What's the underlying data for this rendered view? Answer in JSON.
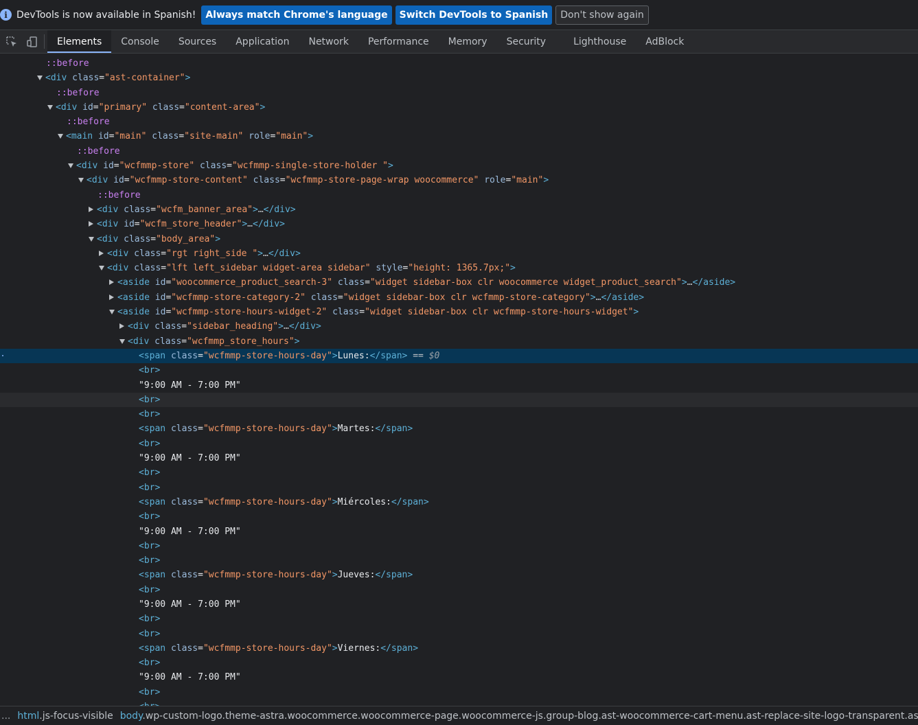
{
  "infobar": {
    "message": "DevTools is now available in Spanish!",
    "btn_match": "Always match Chrome's language",
    "btn_switch": "Switch DevTools to Spanish",
    "btn_dismiss": "Don't show again"
  },
  "tabs": [
    "Elements",
    "Console",
    "Sources",
    "Application",
    "Network",
    "Performance",
    "Memory",
    "Security",
    "Lighthouse",
    "AdBlock"
  ],
  "active_tab": "Elements",
  "tree": [
    {
      "indent": 67,
      "caret": "",
      "parts": [
        [
          "pseudo",
          "::before"
        ]
      ]
    },
    {
      "indent": 52,
      "caret": "open",
      "parts": [
        [
          "tag",
          "<div"
        ],
        [
          "attr",
          " class"
        ],
        [
          "plain",
          "="
        ],
        [
          "val",
          "\"ast-container\""
        ],
        [
          "tag",
          ">"
        ]
      ]
    },
    {
      "indent": 82,
      "caret": "",
      "parts": [
        [
          "pseudo",
          "::before"
        ]
      ]
    },
    {
      "indent": 67,
      "caret": "open",
      "parts": [
        [
          "tag",
          "<div"
        ],
        [
          "attr",
          " id"
        ],
        [
          "plain",
          "="
        ],
        [
          "val",
          "\"primary\""
        ],
        [
          "attr",
          " class"
        ],
        [
          "plain",
          "="
        ],
        [
          "val",
          "\"content-area\""
        ],
        [
          "tag",
          ">"
        ]
      ]
    },
    {
      "indent": 97,
      "caret": "",
      "parts": [
        [
          "pseudo",
          "::before"
        ]
      ]
    },
    {
      "indent": 82,
      "caret": "open",
      "parts": [
        [
          "tag",
          "<main"
        ],
        [
          "attr",
          " id"
        ],
        [
          "plain",
          "="
        ],
        [
          "val",
          "\"main\""
        ],
        [
          "attr",
          " class"
        ],
        [
          "plain",
          "="
        ],
        [
          "val",
          "\"site-main\""
        ],
        [
          "attr",
          " role"
        ],
        [
          "plain",
          "="
        ],
        [
          "val",
          "\"main\""
        ],
        [
          "tag",
          ">"
        ]
      ]
    },
    {
      "indent": 112,
      "caret": "",
      "parts": [
        [
          "pseudo",
          "::before"
        ]
      ]
    },
    {
      "indent": 97,
      "caret": "open",
      "parts": [
        [
          "tag",
          "<div"
        ],
        [
          "attr",
          " id"
        ],
        [
          "plain",
          "="
        ],
        [
          "val",
          "\"wcfmmp-store\""
        ],
        [
          "attr",
          " class"
        ],
        [
          "plain",
          "="
        ],
        [
          "val",
          "\"wcfmmp-single-store-holder \""
        ],
        [
          "tag",
          ">"
        ]
      ]
    },
    {
      "indent": 112,
      "caret": "open",
      "parts": [
        [
          "tag",
          "<div"
        ],
        [
          "attr",
          " id"
        ],
        [
          "plain",
          "="
        ],
        [
          "val",
          "\"wcfmmp-store-content\""
        ],
        [
          "attr",
          " class"
        ],
        [
          "plain",
          "="
        ],
        [
          "val",
          "\"wcfmmp-store-page-wrap woocommerce\""
        ],
        [
          "attr",
          " role"
        ],
        [
          "plain",
          "="
        ],
        [
          "val",
          "\"main\""
        ],
        [
          "tag",
          ">"
        ]
      ]
    },
    {
      "indent": 142,
      "caret": "",
      "parts": [
        [
          "pseudo",
          "::before"
        ]
      ]
    },
    {
      "indent": 127,
      "caret": "closed",
      "parts": [
        [
          "tag",
          "<div"
        ],
        [
          "attr",
          " class"
        ],
        [
          "plain",
          "="
        ],
        [
          "val",
          "\"wcfm_banner_area\""
        ],
        [
          "tag",
          ">"
        ],
        [
          "dots",
          "…"
        ],
        [
          "tag",
          "</div>"
        ]
      ]
    },
    {
      "indent": 127,
      "caret": "closed",
      "parts": [
        [
          "tag",
          "<div"
        ],
        [
          "attr",
          " id"
        ],
        [
          "plain",
          "="
        ],
        [
          "val",
          "\"wcfm_store_header\""
        ],
        [
          "tag",
          ">"
        ],
        [
          "dots",
          "…"
        ],
        [
          "tag",
          "</div>"
        ]
      ]
    },
    {
      "indent": 127,
      "caret": "open",
      "parts": [
        [
          "tag",
          "<div"
        ],
        [
          "attr",
          " class"
        ],
        [
          "plain",
          "="
        ],
        [
          "val",
          "\"body_area\""
        ],
        [
          "tag",
          ">"
        ]
      ]
    },
    {
      "indent": 142,
      "caret": "closed",
      "parts": [
        [
          "tag",
          "<div"
        ],
        [
          "attr",
          " class"
        ],
        [
          "plain",
          "="
        ],
        [
          "val",
          "\"rgt right_side \""
        ],
        [
          "tag",
          ">"
        ],
        [
          "dots",
          "…"
        ],
        [
          "tag",
          "</div>"
        ]
      ]
    },
    {
      "indent": 142,
      "caret": "open",
      "parts": [
        [
          "tag",
          "<div"
        ],
        [
          "attr",
          " class"
        ],
        [
          "plain",
          "="
        ],
        [
          "val",
          "\"lft left_sidebar widget-area sidebar\""
        ],
        [
          "attr",
          " style"
        ],
        [
          "plain",
          "="
        ],
        [
          "val",
          "\"height: 1365.7px;\""
        ],
        [
          "tag",
          ">"
        ]
      ]
    },
    {
      "indent": 157,
      "caret": "closed",
      "parts": [
        [
          "tag",
          "<aside"
        ],
        [
          "attr",
          " id"
        ],
        [
          "plain",
          "="
        ],
        [
          "val",
          "\"woocommerce_product_search-3\""
        ],
        [
          "attr",
          " class"
        ],
        [
          "plain",
          "="
        ],
        [
          "val",
          "\"widget sidebar-box clr woocommerce widget_product_search\""
        ],
        [
          "tag",
          ">"
        ],
        [
          "dots",
          "…"
        ],
        [
          "tag",
          "</aside>"
        ]
      ]
    },
    {
      "indent": 157,
      "caret": "closed",
      "parts": [
        [
          "tag",
          "<aside"
        ],
        [
          "attr",
          " id"
        ],
        [
          "plain",
          "="
        ],
        [
          "val",
          "\"wcfmmp-store-category-2\""
        ],
        [
          "attr",
          " class"
        ],
        [
          "plain",
          "="
        ],
        [
          "val",
          "\"widget sidebar-box clr wcfmmp-store-category\""
        ],
        [
          "tag",
          ">"
        ],
        [
          "dots",
          "…"
        ],
        [
          "tag",
          "</aside>"
        ]
      ]
    },
    {
      "indent": 157,
      "caret": "open",
      "parts": [
        [
          "tag",
          "<aside"
        ],
        [
          "attr",
          " id"
        ],
        [
          "plain",
          "="
        ],
        [
          "val",
          "\"wcfmmp-store-hours-widget-2\""
        ],
        [
          "attr",
          " class"
        ],
        [
          "plain",
          "="
        ],
        [
          "val",
          "\"widget sidebar-box clr wcfmmp-store-hours-widget\""
        ],
        [
          "tag",
          ">"
        ]
      ]
    },
    {
      "indent": 172,
      "caret": "closed",
      "parts": [
        [
          "tag",
          "<div"
        ],
        [
          "attr",
          " class"
        ],
        [
          "plain",
          "="
        ],
        [
          "val",
          "\"sidebar_heading\""
        ],
        [
          "tag",
          ">"
        ],
        [
          "dots",
          "…"
        ],
        [
          "tag",
          "</div>"
        ]
      ]
    },
    {
      "indent": 172,
      "caret": "open",
      "parts": [
        [
          "tag",
          "<div"
        ],
        [
          "attr",
          " class"
        ],
        [
          "plain",
          "="
        ],
        [
          "val",
          "\"wcfmmp_store_hours\""
        ],
        [
          "tag",
          ">"
        ]
      ]
    },
    {
      "indent": 202,
      "caret": "",
      "state": "selected",
      "parts": [
        [
          "tag",
          "<span"
        ],
        [
          "attr",
          " class"
        ],
        [
          "plain",
          "="
        ],
        [
          "val",
          "\"wcfmmp-store-hours-day\""
        ],
        [
          "tag",
          ">"
        ],
        [
          "plain",
          "Lunes:"
        ],
        [
          "tag",
          "</span>"
        ],
        [
          "sel-mark",
          " == "
        ],
        [
          "dollar",
          "$0"
        ]
      ]
    },
    {
      "indent": 202,
      "caret": "",
      "parts": [
        [
          "tag",
          "<br>"
        ]
      ]
    },
    {
      "indent": 202,
      "caret": "",
      "parts": [
        [
          "plain",
          "\"9:00 AM - 7:00 PM\""
        ]
      ]
    },
    {
      "indent": 202,
      "caret": "",
      "state": "hover",
      "parts": [
        [
          "tag",
          "<br>"
        ]
      ]
    },
    {
      "indent": 202,
      "caret": "",
      "parts": [
        [
          "tag",
          "<br>"
        ]
      ]
    },
    {
      "indent": 202,
      "caret": "",
      "parts": [
        [
          "tag",
          "<span"
        ],
        [
          "attr",
          " class"
        ],
        [
          "plain",
          "="
        ],
        [
          "val",
          "\"wcfmmp-store-hours-day\""
        ],
        [
          "tag",
          ">"
        ],
        [
          "plain",
          "Martes:"
        ],
        [
          "tag",
          "</span>"
        ]
      ]
    },
    {
      "indent": 202,
      "caret": "",
      "parts": [
        [
          "tag",
          "<br>"
        ]
      ]
    },
    {
      "indent": 202,
      "caret": "",
      "parts": [
        [
          "plain",
          "\"9:00 AM - 7:00 PM\""
        ]
      ]
    },
    {
      "indent": 202,
      "caret": "",
      "parts": [
        [
          "tag",
          "<br>"
        ]
      ]
    },
    {
      "indent": 202,
      "caret": "",
      "parts": [
        [
          "tag",
          "<br>"
        ]
      ]
    },
    {
      "indent": 202,
      "caret": "",
      "parts": [
        [
          "tag",
          "<span"
        ],
        [
          "attr",
          " class"
        ],
        [
          "plain",
          "="
        ],
        [
          "val",
          "\"wcfmmp-store-hours-day\""
        ],
        [
          "tag",
          ">"
        ],
        [
          "plain",
          "Miércoles:"
        ],
        [
          "tag",
          "</span>"
        ]
      ]
    },
    {
      "indent": 202,
      "caret": "",
      "parts": [
        [
          "tag",
          "<br>"
        ]
      ]
    },
    {
      "indent": 202,
      "caret": "",
      "parts": [
        [
          "plain",
          "\"9:00 AM - 7:00 PM\""
        ]
      ]
    },
    {
      "indent": 202,
      "caret": "",
      "parts": [
        [
          "tag",
          "<br>"
        ]
      ]
    },
    {
      "indent": 202,
      "caret": "",
      "parts": [
        [
          "tag",
          "<br>"
        ]
      ]
    },
    {
      "indent": 202,
      "caret": "",
      "parts": [
        [
          "tag",
          "<span"
        ],
        [
          "attr",
          " class"
        ],
        [
          "plain",
          "="
        ],
        [
          "val",
          "\"wcfmmp-store-hours-day\""
        ],
        [
          "tag",
          ">"
        ],
        [
          "plain",
          "Jueves:"
        ],
        [
          "tag",
          "</span>"
        ]
      ]
    },
    {
      "indent": 202,
      "caret": "",
      "parts": [
        [
          "tag",
          "<br>"
        ]
      ]
    },
    {
      "indent": 202,
      "caret": "",
      "parts": [
        [
          "plain",
          "\"9:00 AM - 7:00 PM\""
        ]
      ]
    },
    {
      "indent": 202,
      "caret": "",
      "parts": [
        [
          "tag",
          "<br>"
        ]
      ]
    },
    {
      "indent": 202,
      "caret": "",
      "parts": [
        [
          "tag",
          "<br>"
        ]
      ]
    },
    {
      "indent": 202,
      "caret": "",
      "parts": [
        [
          "tag",
          "<span"
        ],
        [
          "attr",
          " class"
        ],
        [
          "plain",
          "="
        ],
        [
          "val",
          "\"wcfmmp-store-hours-day\""
        ],
        [
          "tag",
          ">"
        ],
        [
          "plain",
          "Viernes:"
        ],
        [
          "tag",
          "</span>"
        ]
      ]
    },
    {
      "indent": 202,
      "caret": "",
      "parts": [
        [
          "tag",
          "<br>"
        ]
      ]
    },
    {
      "indent": 202,
      "caret": "",
      "parts": [
        [
          "plain",
          "\"9:00 AM - 7:00 PM\""
        ]
      ]
    },
    {
      "indent": 202,
      "caret": "",
      "parts": [
        [
          "tag",
          "<br>"
        ]
      ]
    },
    {
      "indent": 202,
      "caret": "",
      "parts": [
        [
          "tag",
          "<br>"
        ]
      ]
    }
  ],
  "breadcrumb": {
    "more": "...",
    "items": [
      {
        "tag": "html",
        "cls": ".js-focus-visible"
      },
      {
        "tag": "body",
        "cls": ".wp-custom-logo.theme-astra.woocommerce.woocommerce-page.woocommerce-js.group-blog.ast-woocommerce-cart-menu.ast-replace-site-logo-transparent.ast-inher"
      }
    ]
  }
}
